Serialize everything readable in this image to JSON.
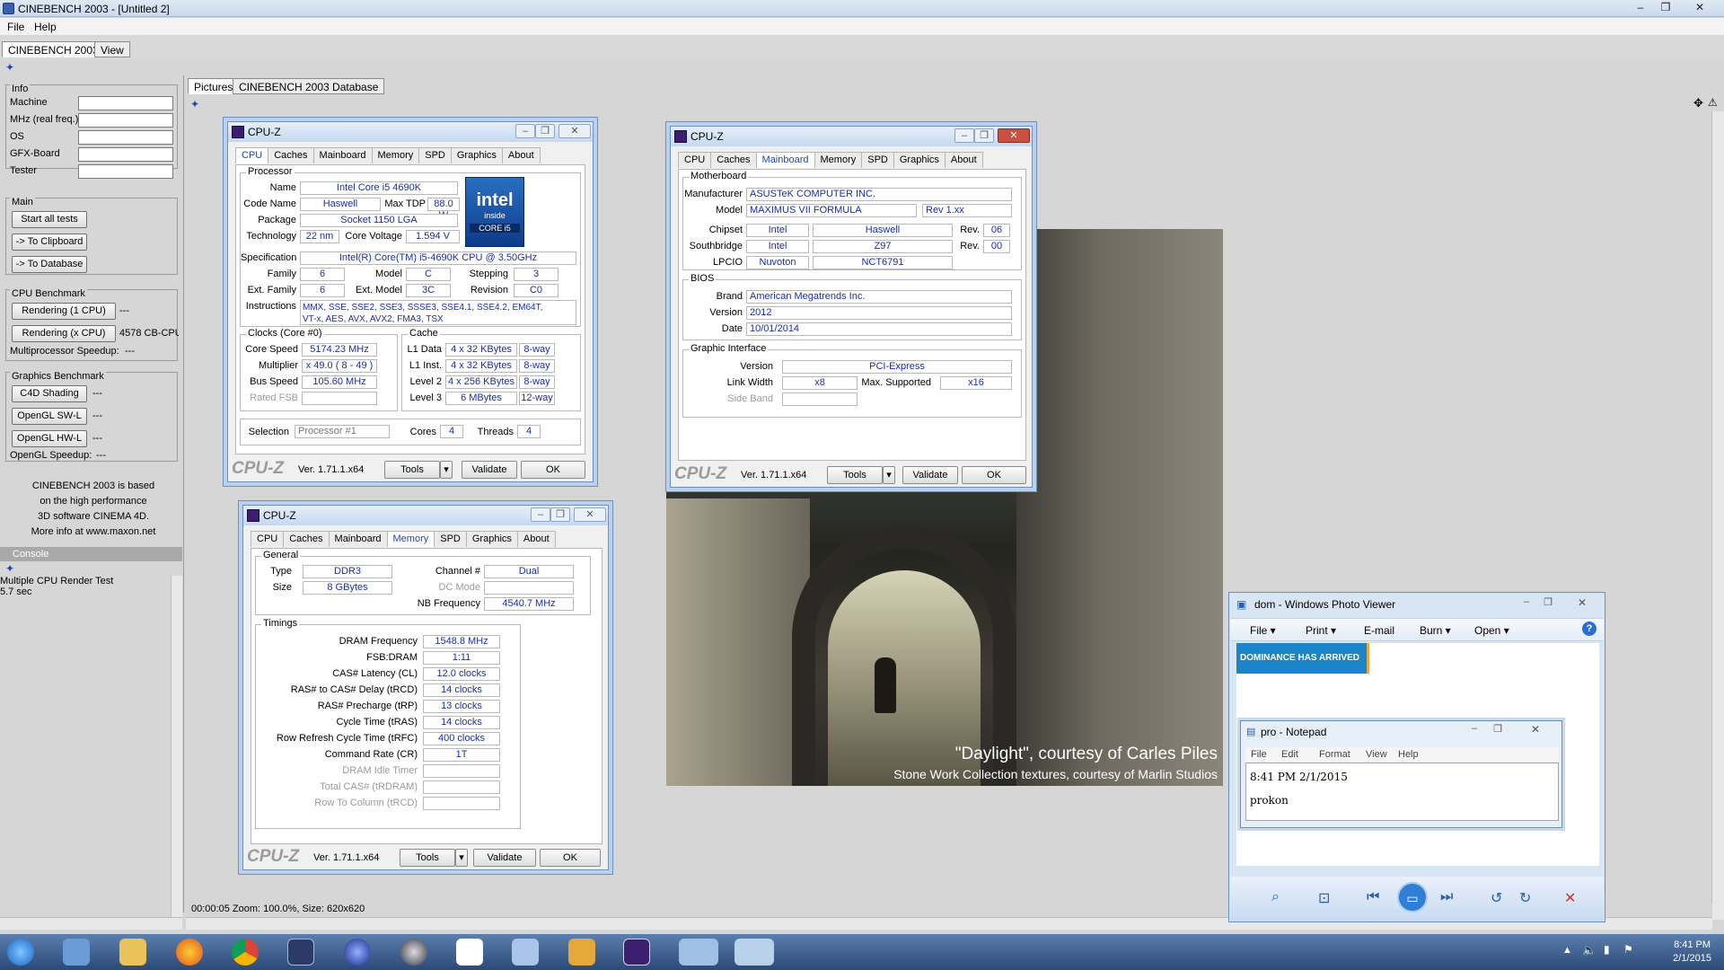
{
  "window": {
    "title": "CINEBENCH 2003 - [Untitled 2]",
    "min": "–",
    "max": "❐",
    "close": "✕"
  },
  "menu": {
    "file": "File",
    "help": "Help"
  },
  "top_tabs": [
    "CINEBENCH 2003",
    "View"
  ],
  "info": {
    "header": "Info",
    "labels": [
      "Machine",
      "MHz (real freq.)",
      "OS",
      "GFX-Board",
      "Tester"
    ]
  },
  "main": {
    "header": "Main",
    "start": "Start all tests",
    "clipboard": "-> To Clipboard",
    "database": "-> To Database"
  },
  "cpu_bench": {
    "header": "CPU Benchmark",
    "r1": "Rendering (1 CPU)",
    "r1_val": "---",
    "rx": "Rendering (x CPU)",
    "rx_val": "4578 CB-CPU",
    "mp": "Multiprocessor Speedup:",
    "mp_val": "---"
  },
  "gfx_bench": {
    "header": "Graphics Benchmark",
    "c4d": "C4D Shading",
    "c4d_val": "---",
    "swl": "OpenGL SW-L",
    "swl_val": "---",
    "hwl": "OpenGL HW-L",
    "hwl_val": "---",
    "speedup": "OpenGL Speedup:",
    "speedup_val": "---"
  },
  "about_text": [
    "CINEBENCH 2003 is based",
    "on the high performance",
    "3D software CINEMA 4D.",
    "More info at www.maxon.net"
  ],
  "console": {
    "header": "Console",
    "lines": [
      "Multiple CPU Render Test",
      "5.7 sec"
    ]
  },
  "right_tabs": [
    "Pictures",
    "CINEBENCH 2003 Database"
  ],
  "status": "00:00:05  Zoom: 100.0%, Size: 620x620",
  "render": {
    "caption1": "\"Daylight\", courtesy of Carles Piles",
    "caption2": "Stone Work Collection textures, courtesy of Marlin Studios"
  },
  "cpuz_common": {
    "title": "CPU-Z",
    "logo": "CPU-Z",
    "version": "Ver. 1.71.1.x64",
    "tools": "Tools",
    "validate": "Validate",
    "ok": "OK",
    "tabs": [
      "CPU",
      "Caches",
      "Mainboard",
      "Memory",
      "SPD",
      "Graphics",
      "About"
    ]
  },
  "cpu": {
    "processor": "Processor",
    "name_l": "Name",
    "name": "Intel Core i5 4690K",
    "code_l": "Code Name",
    "code": "Haswell",
    "tdp_l": "Max TDP",
    "tdp": "88.0 W",
    "pkg_l": "Package",
    "pkg": "Socket 1150 LGA",
    "tech_l": "Technology",
    "tech": "22 nm",
    "volt_l": "Core Voltage",
    "volt": "1.594 V",
    "spec_l": "Specification",
    "spec": "Intel(R) Core(TM) i5-4690K CPU @ 3.50GHz",
    "fam_l": "Family",
    "fam": "6",
    "model_l": "Model",
    "model": "C",
    "step_l": "Stepping",
    "step": "3",
    "efam_l": "Ext. Family",
    "efam": "6",
    "emodel_l": "Ext. Model",
    "emodel": "3C",
    "rev_l": "Revision",
    "rev": "C0",
    "inst_l": "Instructions",
    "inst1": "MMX, SSE, SSE2, SSE3, SSSE3, SSE4.1, SSE4.2, EM64T,",
    "inst2": "VT-x, AES, AVX, AVX2, FMA3, TSX",
    "clocks": "Clocks (Core #0)",
    "cs_l": "Core Speed",
    "cs": "5174.23 MHz",
    "mul_l": "Multiplier",
    "mul": "x 49.0 ( 8 - 49 )",
    "bus_l": "Bus Speed",
    "bus": "105.60 MHz",
    "fsb_l": "Rated FSB",
    "cache": "Cache",
    "l1d_l": "L1 Data",
    "l1d": "4 x 32 KBytes",
    "l1d_w": "8-way",
    "l1i_l": "L1 Inst.",
    "l1i": "4 x 32 KBytes",
    "l1i_w": "8-way",
    "l2_l": "Level 2",
    "l2": "4 x 256 KBytes",
    "l2_w": "8-way",
    "l3_l": "Level 3",
    "l3": "6 MBytes",
    "l3_w": "12-way",
    "sel_l": "Selection",
    "sel": "Processor #1",
    "cores_l": "Cores",
    "cores": "4",
    "thr_l": "Threads",
    "thr": "4",
    "intel1": "intel",
    "intel2": "inside",
    "intel3": "CORE i5"
  },
  "mb": {
    "motherboard": "Motherboard",
    "man_l": "Manufacturer",
    "man": "ASUSTeK COMPUTER INC.",
    "model_l": "Model",
    "model": "MAXIMUS VII FORMULA",
    "rev": "Rev 1.xx",
    "chip_l": "Chipset",
    "chip1": "Intel",
    "chip2": "Haswell",
    "chiprev_l": "Rev.",
    "chiprev": "06",
    "sb_l": "Southbridge",
    "sb1": "Intel",
    "sb2": "Z97",
    "sbrev_l": "Rev.",
    "sbrev": "00",
    "lpc_l": "LPCIO",
    "lpc1": "Nuvoton",
    "lpc2": "NCT6791",
    "bios": "BIOS",
    "brand_l": "Brand",
    "brand": "American Megatrends Inc.",
    "ver_l": "Version",
    "ver": "2012",
    "date_l": "Date",
    "date": "10/01/2014",
    "gi": "Graphic Interface",
    "giver_l": "Version",
    "giver": "PCI-Express",
    "lw_l": "Link Width",
    "lw": "x8",
    "ms_l": "Max. Supported",
    "ms": "x16",
    "sideband_l": "Side Band"
  },
  "mem": {
    "general": "General",
    "type_l": "Type",
    "type": "DDR3",
    "ch_l": "Channel #",
    "ch": "Dual",
    "size_l": "Size",
    "size": "8 GBytes",
    "dc_l": "DC Mode",
    "nb_l": "NB Frequency",
    "nb": "4540.7 MHz",
    "timings": "Timings",
    "rows": [
      {
        "l": "DRAM Frequency",
        "v": "1548.8 MHz"
      },
      {
        "l": "FSB:DRAM",
        "v": "1:11"
      },
      {
        "l": "CAS# Latency (CL)",
        "v": "12.0 clocks"
      },
      {
        "l": "RAS# to CAS# Delay (tRCD)",
        "v": "14 clocks"
      },
      {
        "l": "RAS# Precharge (tRP)",
        "v": "13 clocks"
      },
      {
        "l": "Cycle Time (tRAS)",
        "v": "14 clocks"
      },
      {
        "l": "Row Refresh Cycle Time (tRFC)",
        "v": "400 clocks"
      },
      {
        "l": "Command Rate (CR)",
        "v": "1T"
      },
      {
        "l": "DRAM Idle Timer",
        "v": ""
      },
      {
        "l": "Total CAS# (tRDRAM)",
        "v": ""
      },
      {
        "l": "Row To Column (tRCD)",
        "v": ""
      }
    ]
  },
  "photo_viewer": {
    "title": "dom - Windows Photo Viewer",
    "menu": [
      "File ▾",
      "Print ▾",
      "E-mail",
      "Burn ▾",
      "Open ▾"
    ],
    "banner": "DOMINANCE HAS ARRIVED"
  },
  "notepad": {
    "title": "pro - Notepad",
    "menu": [
      "File",
      "Edit",
      "Format",
      "View",
      "Help"
    ],
    "line1": "8:41 PM 2/1/2015",
    "line2": "prokon"
  },
  "clock": {
    "time": "8:41 PM",
    "date": "2/1/2015"
  }
}
